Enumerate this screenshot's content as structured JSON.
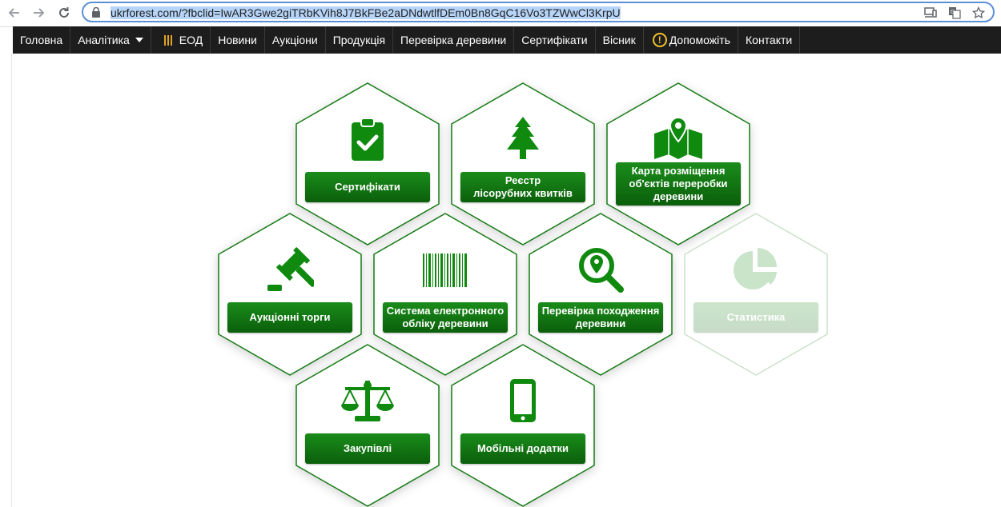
{
  "browser": {
    "url_host": "ukrforest.com/",
    "url_query": "?fbclid=IwAR3Gwe2giTRbKVih8J7BkFBe2aDNdwtlfDEm0Bn8GqC16Vo3TZWwCl3KrpU"
  },
  "nav": {
    "items": [
      {
        "label": "Головна"
      },
      {
        "label": "Аналітика"
      },
      {
        "label": "ЕОД"
      },
      {
        "label": "Новини"
      },
      {
        "label": "Аукціони"
      },
      {
        "label": "Продукція"
      },
      {
        "label": "Перевірка деревини"
      },
      {
        "label": "Сертифікати"
      },
      {
        "label": "Вісник"
      },
      {
        "label": "Допоможіть"
      },
      {
        "label": "Контакти"
      }
    ]
  },
  "tiles": [
    {
      "label": "Сертифікати",
      "icon": "clipboard-check-icon"
    },
    {
      "label": "Реєстр\nлісорубних квитків",
      "icon": "fir-tree-icon"
    },
    {
      "label": "Карта розміщення\nоб'єктів переробки\nдеревини",
      "icon": "map-pin-icon"
    },
    {
      "label": "Аукціонні торги",
      "icon": "gavel-icon"
    },
    {
      "label": "Система електронного\nобліку деревини",
      "icon": "barcode-icon"
    },
    {
      "label": "Перевірка походження\nдеревини",
      "icon": "magnifier-pin-icon"
    },
    {
      "label": "Статистика",
      "icon": "pie-chart-icon"
    },
    {
      "label": "Закупівлі",
      "icon": "scales-icon"
    },
    {
      "label": "Мобільні додатки",
      "icon": "smartphone-icon"
    }
  ],
  "colors": {
    "accent_green": "#0b7a0b",
    "nav_bg": "#1d1d1d",
    "eod_bars": "#e3a521",
    "help_icon": "#f2c12e"
  }
}
